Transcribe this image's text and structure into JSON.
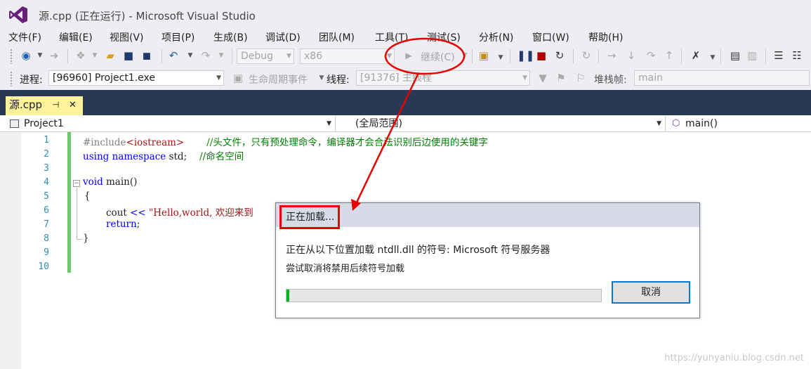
{
  "window": {
    "title": "源.cpp (正在运行) - Microsoft Visual Studio"
  },
  "menu": [
    "文件(F)",
    "编辑(E)",
    "视图(V)",
    "项目(P)",
    "生成(B)",
    "调试(D)",
    "团队(M)",
    "工具(T)",
    "测试(S)",
    "分析(N)",
    "窗口(W)",
    "帮助(H)"
  ],
  "toolbar": {
    "configuration": "Debug",
    "platform": "x86",
    "continue_label": "继续(C)"
  },
  "debug_location": {
    "process_label": "进程:",
    "process_value": "[96960] Project1.exe",
    "lifecycle_label": "生命周期事件",
    "thread_label": "线程:",
    "thread_value": "[91376] 主线程",
    "stackframe_label": "堆栈帧:",
    "stackframe_value": "main"
  },
  "tab": {
    "filename": "源.cpp"
  },
  "navbar": {
    "project": "Project1",
    "scope": "(全局范围)",
    "function": "main()"
  },
  "editor": {
    "line_numbers": [
      "1",
      "2",
      "3",
      "4",
      "5",
      "6",
      "7",
      "8",
      "9",
      "10"
    ],
    "lines": {
      "l1_directive": "#include",
      "l1_header": "<iostream>",
      "l1_comment": "//头文件，只有预处理命令，编译器才会合法识别后边使用的关键字",
      "l2_using": "using",
      "l2_namespace": "namespace",
      "l2_rest": " std;",
      "l2_comment": "//命名空间",
      "l4_void": "void",
      "l4_rest": " main()",
      "l5": "{",
      "l6_cout": "cout ",
      "l6_op": "<<",
      "l6_str": " \"Hello,world, 欢迎来到",
      "l7_return": "return",
      "l7_rest": ";",
      "l8": "}"
    }
  },
  "dialog": {
    "title": "正在加载...",
    "message": "正在从以下位置加载 ntdll.dll 的符号: Microsoft 符号服务器",
    "hint": "尝试取消将禁用后续符号加载",
    "progress_percent": 1,
    "cancel_label": "取消"
  },
  "watermark": "https://yunyaniu.blog.csdn.net",
  "colors": {
    "tab_active": "#fff29d",
    "tab_strip": "#293955",
    "annotation_red": "#e60000",
    "progress_green": "#06b025",
    "accent_blue": "#0078d7"
  }
}
